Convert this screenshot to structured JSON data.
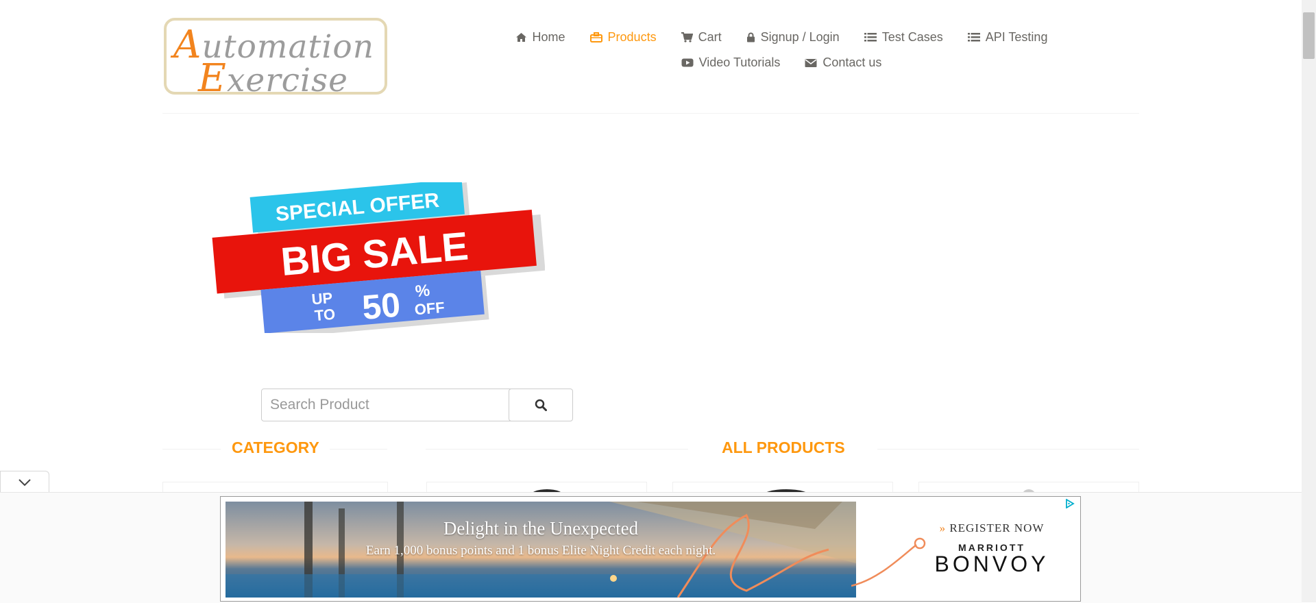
{
  "header": {
    "logo": {
      "line1_cap": "A",
      "line1_rest": "utomation",
      "line2_cap": "E",
      "line2_rest": "xercise"
    },
    "nav_row1": [
      {
        "label": "Home",
        "icon": "home-icon"
      },
      {
        "label": "Products",
        "icon": "briefcase-icon",
        "active": true
      },
      {
        "label": "Cart",
        "icon": "cart-icon"
      },
      {
        "label": "Signup / Login",
        "icon": "lock-icon"
      },
      {
        "label": "Test Cases",
        "icon": "list-icon"
      },
      {
        "label": "API Testing",
        "icon": "list-icon"
      }
    ],
    "nav_row2": [
      {
        "label": "Video Tutorials",
        "icon": "youtube-icon"
      },
      {
        "label": "Contact us",
        "icon": "envelope-icon"
      }
    ]
  },
  "banner": {
    "line1": "SPECIAL OFFER",
    "line2": "BIG SALE",
    "up": "UP",
    "to": "TO",
    "percent_value": "50",
    "percent_sign": "%",
    "off": "OFF"
  },
  "search": {
    "placeholder": "Search Product",
    "value": ""
  },
  "sections": {
    "category": "CATEGORY",
    "all_products": "ALL PRODUCTS"
  },
  "ad": {
    "headline": "Delight in the Unexpected",
    "body": "Earn 1,000 bonus points and 1 bonus Elite Night Credit each night.",
    "cta_chevrons": "»",
    "cta": "REGISTER NOW",
    "brand_top": "MARRIOTT",
    "brand": "BONVOY"
  },
  "colors": {
    "accent": "#fe980f",
    "text": "#696763",
    "banner_cyan": "#2bc4ea",
    "banner_red": "#e8140c",
    "banner_blue": "#5b84e8"
  }
}
